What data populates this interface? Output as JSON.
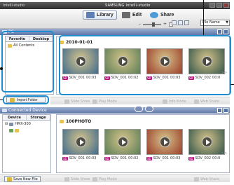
{
  "window": {
    "app_title": "Intelli-studio",
    "brand": "SAMSUNG Intelli-studio"
  },
  "toolbar": {
    "library_label": "Library",
    "edit_label": "Edit",
    "share_label": "Share",
    "sort_value": "File Name"
  },
  "library_panel": {
    "title": "PC",
    "tabs": [
      "Favorite",
      "Desktop"
    ],
    "tree_item": "All Contents",
    "import_label": "Import Folder"
  },
  "library_content": {
    "group_title": "2010-01-01",
    "items": [
      {
        "badge": "SD",
        "name": "SDV_001",
        "duration": "00:03",
        "bg": "#3f6b8e"
      },
      {
        "badge": "SD",
        "name": "SDV_001",
        "duration": "00:02",
        "bg": "#5b7e56"
      },
      {
        "badge": "SD",
        "name": "SDV_001",
        "duration": "00:03",
        "bg": "#9a3d2a"
      },
      {
        "badge": "SD",
        "name": "SDV_002",
        "duration": "00:0",
        "bg": "#34554a"
      }
    ]
  },
  "action_bar": {
    "slide_show": "Slide Show",
    "play_mode": "Play Mode",
    "info_mode": "Info Mode",
    "web_share": "Web Share"
  },
  "device_panel": {
    "title": "Connected Device",
    "tabs": [
      "Device",
      "Storage"
    ],
    "device_name": "HMX-300",
    "save_label": "Save New File"
  },
  "device_content": {
    "group_title": "100PHOTO",
    "items": [
      {
        "badge": "SD",
        "name": "SDV_001",
        "duration": "00:03",
        "bg": "#3f6b8e"
      },
      {
        "badge": "SD",
        "name": "SDV_001",
        "duration": "00:02",
        "bg": "#5b7e56"
      },
      {
        "badge": "SD",
        "name": "SDV_001",
        "duration": "00:03",
        "bg": "#9a3d2a"
      },
      {
        "badge": "SD",
        "name": "SDV_002",
        "duration": "00:0",
        "bg": "#34554a"
      }
    ]
  },
  "colors": {
    "accent_blue": "#5e77a6",
    "callout": "#1e8ed0",
    "badge": "#b0117b"
  }
}
